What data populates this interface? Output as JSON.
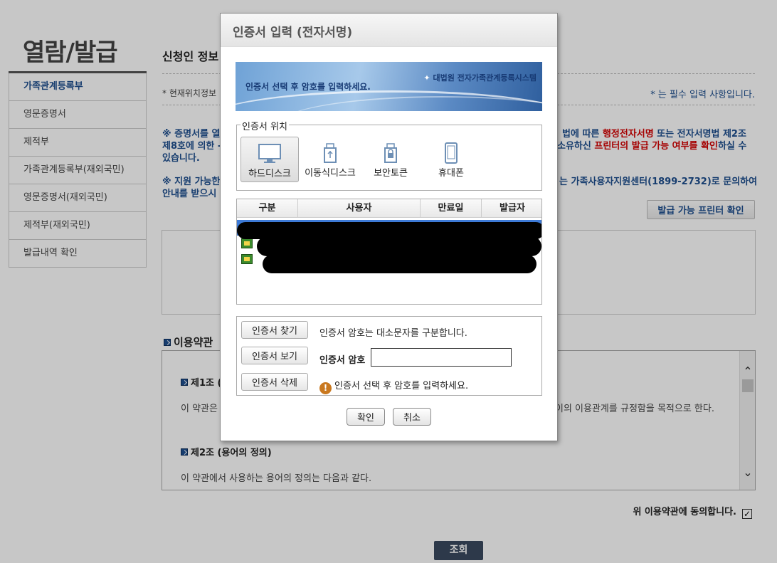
{
  "sidebar": {
    "title": "열람/발급",
    "items": [
      {
        "label": "가족관계등록부"
      },
      {
        "label": "영문증명서"
      },
      {
        "label": "제적부"
      },
      {
        "label": "가족관계등록부(재외국민)"
      },
      {
        "label": "영문증명서(재외국민)"
      },
      {
        "label": "제적부(재외국민)"
      },
      {
        "label": "발급내역 확인"
      }
    ]
  },
  "main": {
    "title": "신청인 정보",
    "location_text": "* 현재위치정보",
    "required_note": "* 는 필수 입력 사항입니다.",
    "notice1_line1_a": "※ 증명서를 열",
    "notice1_line1_b": "법에 따른 ",
    "notice1_line1_red": "행정전자서명",
    "notice1_line1_c": " 또는 전자서명법 제2조",
    "notice1_line2_a": "제8호에 의한 -",
    "notice1_line2_b": "소유하신 ",
    "notice1_line2_red": "프린터의 발급 가능 여부를 확인",
    "notice1_line2_c": "하실 수",
    "notice1_line3": "있습니다.",
    "notice2_line1_a": "※ 지원 가능한",
    "notice2_line1_b": "는 가족사용자지원센터(1899-2732)로 문의하여",
    "notice2_line2": "안내를 받으시",
    "printer_button": "발급 가능 프린터 확인",
    "terms_heading": "이용약관",
    "article1_title": "제1조 (",
    "article1_text_a": "이 약관은",
    "article1_text_b": "이의 이용관계를 규정함을 목적으로 한다.",
    "article2_title": "제2조 (용어의 정의)",
    "article2_text": "이 약관에서 사용하는 용어의 정의는 다음과 같다.",
    "agree_label": "위 이용약관에 동의합니다.",
    "agree_checked": true,
    "search_button": "조회"
  },
  "dialog": {
    "title": "인증서 입력 (전자서명)",
    "banner_text": "인증서 선택 후 암호를 입력하세요.",
    "banner_logo": "대법원 전자가족관계등록시스템",
    "location_legend": "인증서 위치",
    "locations": [
      {
        "label": "하드디스크",
        "icon": "monitor-icon",
        "selected": true
      },
      {
        "label": "이동식디스크",
        "icon": "usb-drive-icon",
        "selected": false
      },
      {
        "label": "보안토큰",
        "icon": "security-token-icon",
        "selected": false
      },
      {
        "label": "휴대폰",
        "icon": "mobile-phone-icon",
        "selected": false
      }
    ],
    "table_headers": [
      "구분",
      "사용자",
      "만료일",
      "발급자"
    ],
    "find_button": "인증서 찾기",
    "view_button": "인증서 보기",
    "delete_button": "인증서 삭제",
    "case_note": "인증서 암호는 대소문자를 구분합니다.",
    "password_label": "인증서 암호",
    "password_value": "",
    "warning_text": "인증서 선택 후 암호를 입력하세요.",
    "ok_button": "확인",
    "cancel_button": "취소",
    "colors": {
      "selected_row": "#3d7ad6",
      "accent": "#1e4f8f",
      "warning": "#c9781f"
    }
  }
}
